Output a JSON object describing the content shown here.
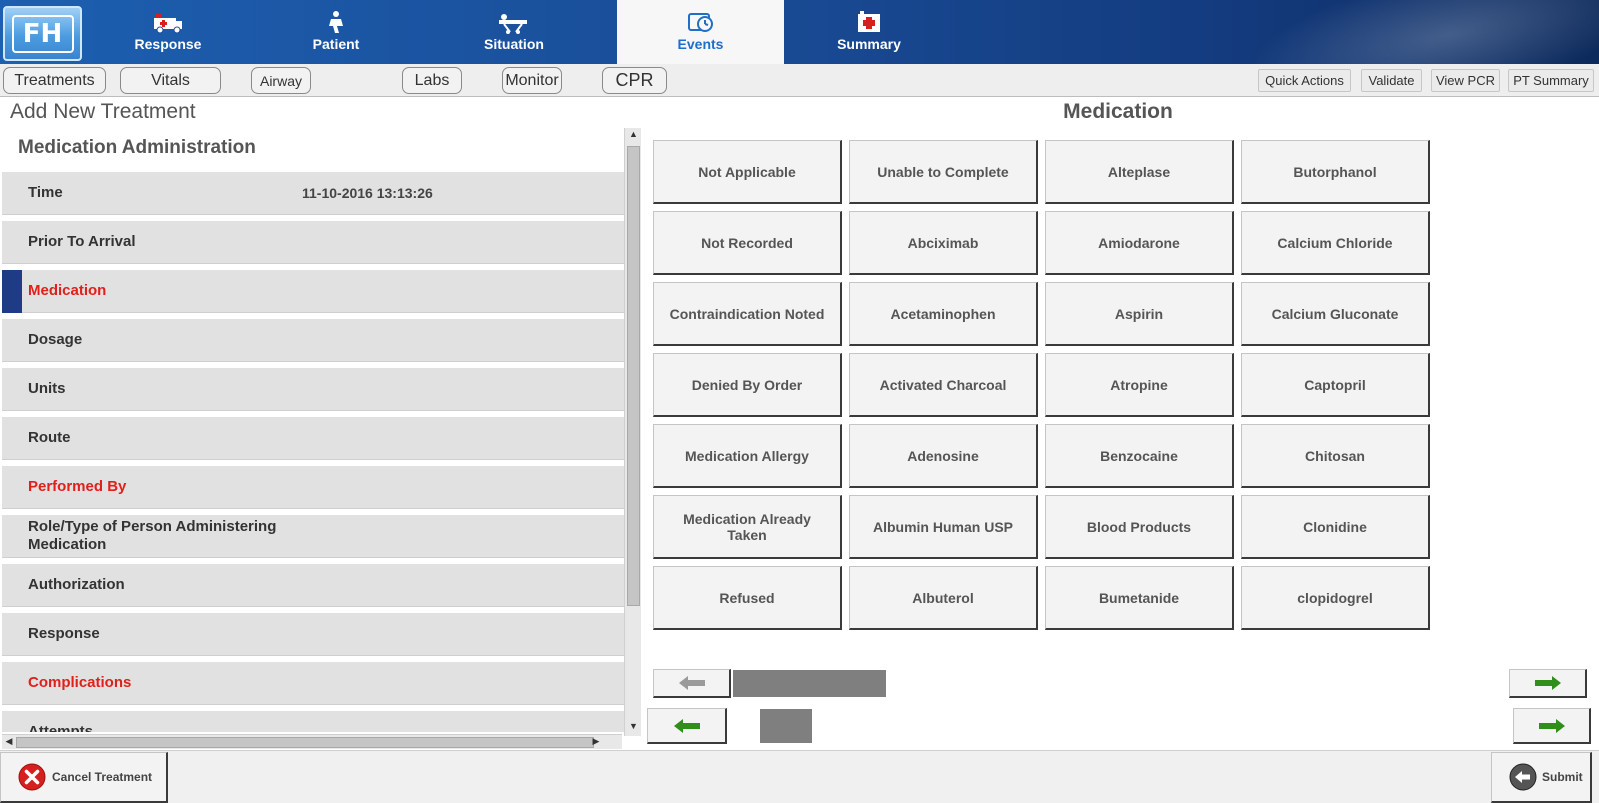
{
  "app": {
    "logo_text": "FH"
  },
  "topnav": {
    "tabs": [
      {
        "label": "Response",
        "icon": "ambulance-icon"
      },
      {
        "label": "Patient",
        "icon": "patient-icon"
      },
      {
        "label": "Situation",
        "icon": "stretcher-icon"
      },
      {
        "label": "Events",
        "icon": "clock-event-icon",
        "active": true
      },
      {
        "label": "Summary",
        "icon": "hospital-icon"
      }
    ]
  },
  "subnav": {
    "tabs": [
      "Treatments",
      "Vitals",
      "Airway",
      "Labs",
      "Monitor",
      "CPR"
    ],
    "actions": [
      "Quick Actions",
      "Validate",
      "View PCR",
      "PT Summary"
    ]
  },
  "left": {
    "title": "Add New Treatment",
    "section": "Medication Administration",
    "fields": [
      {
        "label": "Time",
        "value": "11-10-2016 13:13:26",
        "required": false
      },
      {
        "label": "Prior To Arrival",
        "value": "",
        "required": false
      },
      {
        "label": "Medication",
        "value": "",
        "required": true,
        "selected": true
      },
      {
        "label": "Dosage",
        "value": "",
        "required": false
      },
      {
        "label": "Units",
        "value": "",
        "required": false
      },
      {
        "label": "Route",
        "value": "",
        "required": false
      },
      {
        "label": "Performed By",
        "value": "",
        "required": true
      },
      {
        "label": "Role/Type of Person Administering Medication",
        "value": "",
        "required": false
      },
      {
        "label": "Authorization",
        "value": "",
        "required": false
      },
      {
        "label": "Response",
        "value": "",
        "required": false
      },
      {
        "label": "Complications",
        "value": "",
        "required": true
      },
      {
        "label": "Attempts",
        "value": "",
        "required": false
      }
    ]
  },
  "medication": {
    "title": "Medication",
    "options": [
      "Not Applicable",
      "Unable to Complete",
      "Alteplase",
      "Butorphanol",
      "Not Recorded",
      "Abciximab",
      "Amiodarone",
      "Calcium Chloride",
      "Contraindication Noted",
      "Acetaminophen",
      "Aspirin",
      "Calcium Gluconate",
      "Denied By Order",
      "Activated Charcoal",
      "Atropine",
      "Captopril",
      "Medication Allergy",
      "Adenosine",
      "Benzocaine",
      "Chitosan",
      "Medication Already Taken",
      "Albumin Human USP",
      "Blood Products",
      "Clonidine",
      "Refused",
      "Albuterol",
      "Bumetanide",
      "clopidogrel"
    ]
  },
  "footer": {
    "cancel_label": "Cancel Treatment",
    "submit_label": "Submit"
  },
  "colors": {
    "required": "#e0201b",
    "selected_marker": "#1e3c86",
    "nav_active_text": "#1f6fc9",
    "pager_arrow": "#2f8f1a"
  }
}
